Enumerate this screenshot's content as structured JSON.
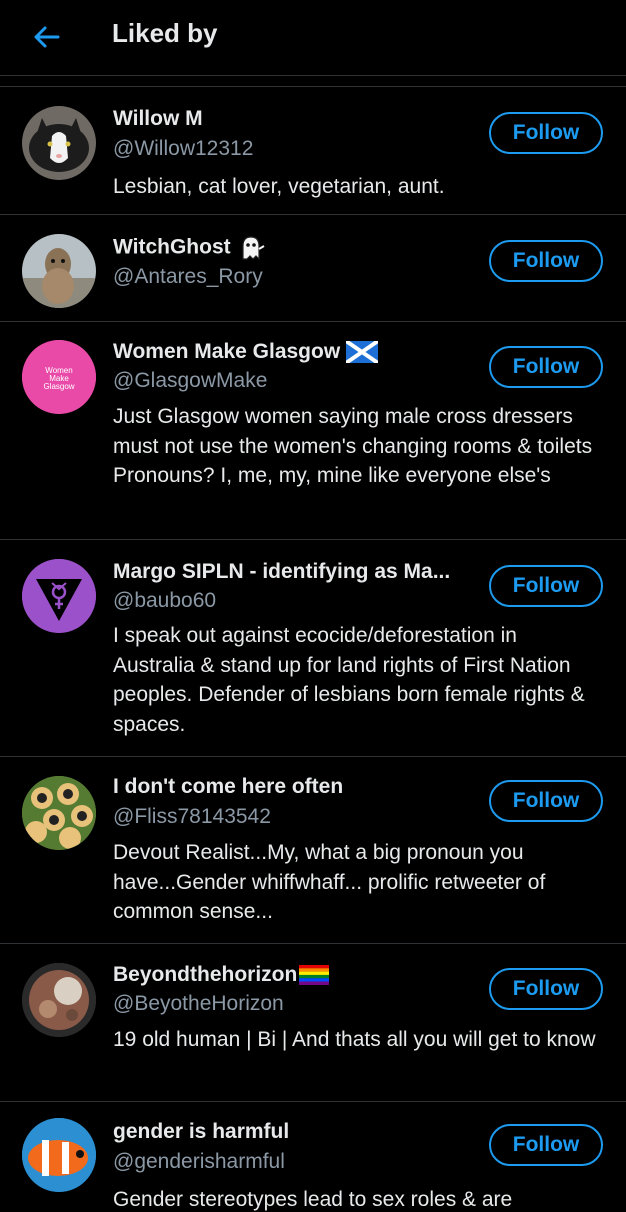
{
  "header": {
    "title": "Liked by",
    "back_icon": "arrow-left-icon"
  },
  "colors": {
    "accent": "#1d9bf0",
    "background": "#000000",
    "secondary_text": "#8b98a5",
    "divider": "#2f3336"
  },
  "users": [
    {
      "name": "Willow M",
      "handle": "@Willow12312",
      "bio": "Lesbian, cat lover, vegetarian, aunt.",
      "follow_label": "Follow"
    },
    {
      "name": "WitchGhost",
      "name_emoji": "ghost",
      "handle": "@Antares_Rory",
      "bio": "",
      "follow_label": "Follow"
    },
    {
      "name": "Women Make Glasgow",
      "name_emoji": "scotland-flag",
      "handle": "@GlasgowMake",
      "avatar_text": [
        "Women",
        "Make",
        "Glasgow"
      ],
      "bio": "Just Glasgow women saying male cross dressers must not use the women's changing rooms & toilets Pronouns? I, me, my, mine like everyone else's",
      "follow_label": "Follow"
    },
    {
      "name": "Margo SIPLN - identifying as Ma...",
      "handle": "@baubo60",
      "bio": "I speak out against ecocide/deforestation in Australia & stand up for land rights of First Nation peoples. Defender of lesbians born female rights & spaces.",
      "follow_label": "Follow"
    },
    {
      "name": "I don't come here often",
      "handle": "@Fliss78143542",
      "bio": "Devout Realist...My, what a big pronoun you have...Gender whiffwhaff... prolific retweeter of common sense...",
      "follow_label": "Follow"
    },
    {
      "name": "Beyondthehorizon",
      "name_emoji": "rainbow-flag",
      "handle": "@BeyotheHorizon",
      "bio": "19 old human | Bi | And thats all you will get to know",
      "follow_label": "Follow"
    },
    {
      "name": "gender is harmful",
      "handle": "@genderisharmful",
      "bio": "Gender stereotypes lead to sex roles & are",
      "follow_label": "Follow"
    }
  ]
}
